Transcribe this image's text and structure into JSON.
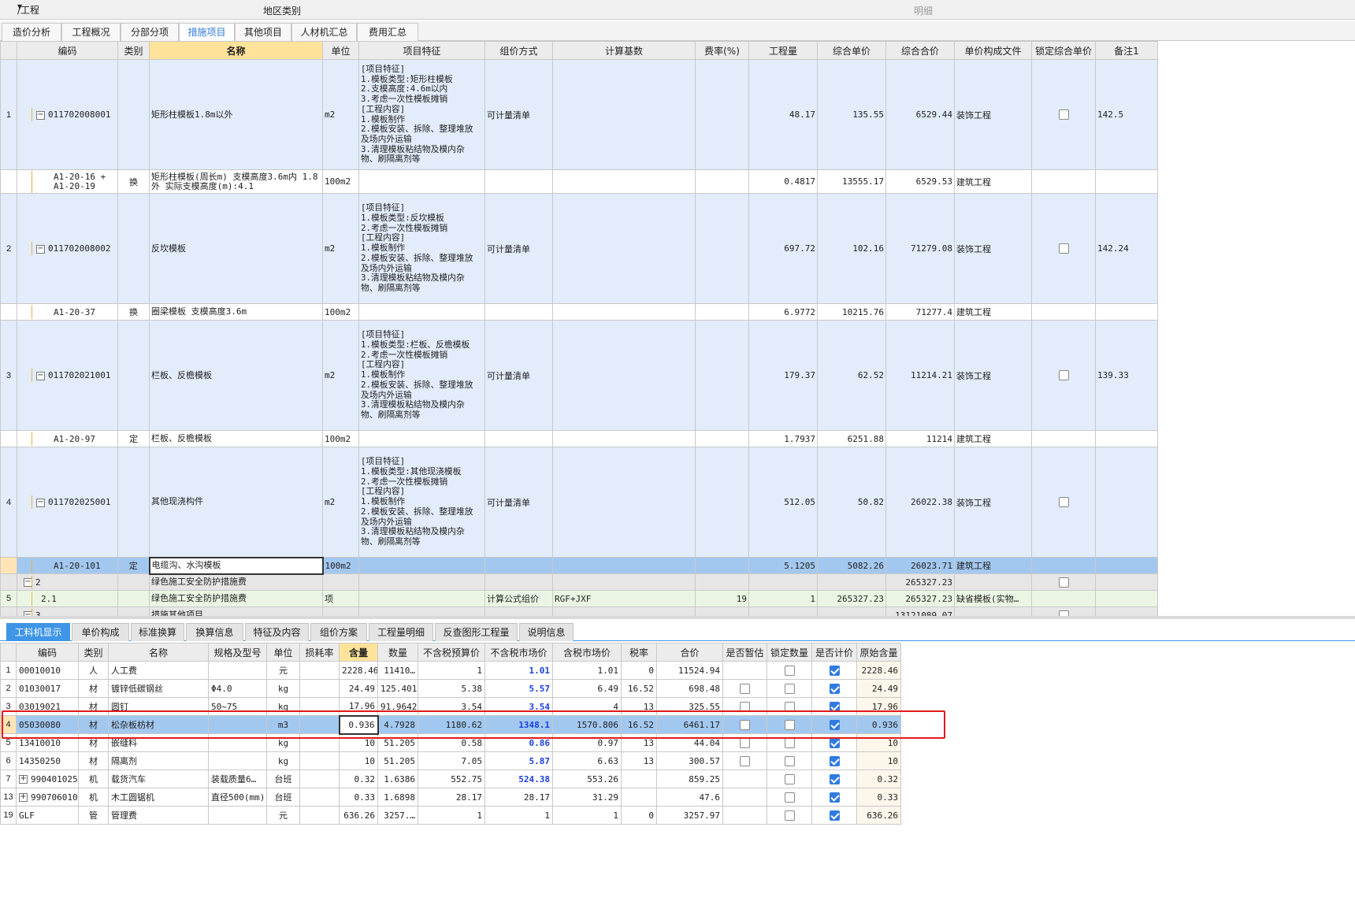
{
  "top_strip": {
    "left_label": "/工程",
    "center_label": "地区类别",
    "right_label": "明细"
  },
  "tabs": [
    {
      "label": "造价分析",
      "active": false
    },
    {
      "label": "工程概况",
      "active": false
    },
    {
      "label": "分部分项",
      "active": false
    },
    {
      "label": "措施项目",
      "active": true
    },
    {
      "label": "其他项目",
      "active": false
    },
    {
      "label": "人材机汇总",
      "active": false
    },
    {
      "label": "费用汇总",
      "active": false
    }
  ],
  "main_grid": {
    "columns": [
      "",
      "编码",
      "类别",
      "名称",
      "单位",
      "项目特征",
      "组价方式",
      "计算基数",
      "费率(%)",
      "工程量",
      "综合单价",
      "综合合价",
      "单价构成文件",
      "锁定综合单价",
      "备注1"
    ],
    "selected_column": "名称",
    "rows": [
      {
        "rn": "1",
        "kind": "qd",
        "code": "011702008001",
        "type": "",
        "name": "矩形柱模板1.8m以外",
        "unit": "m2",
        "features": "[项目特征]\n1.模板类型:矩形柱模板\n2.支模高度:4.6m以内\n3.考虑一次性模板摊销\n[工程内容]\n1.模板制作\n2.模板安装、拆除、整理堆放\n及场内外运输\n3.清理模板粘结物及模内杂\n物、刷隔离剂等",
        "method": "可计量清单",
        "base": "",
        "rate": "",
        "qty": "48.17",
        "price": "135.55",
        "total": "6529.44",
        "file": "装饰工程",
        "lock": "unchecked",
        "note": "142.5"
      },
      {
        "rn": "",
        "kind": "de",
        "code": "A1-20-16 +\nA1-20-19",
        "type": "换",
        "name": "矩形柱模板(周长m) 支模高度3.6m内 1.8\n外  实际支模高度(m):4.1",
        "unit": "100m2",
        "features": "",
        "method": "",
        "base": "",
        "rate": "",
        "qty": "0.4817",
        "price": "13555.17",
        "total": "6529.53",
        "file": "建筑工程",
        "lock": "none",
        "note": ""
      },
      {
        "rn": "2",
        "kind": "qd",
        "code": "011702008002",
        "type": "",
        "name": "反坎模板",
        "unit": "m2",
        "features": "[项目特征]\n1.模板类型:反坎模板\n2.考虑一次性模板摊销\n[工程内容]\n1.模板制作\n2.模板安装、拆除、整理堆放\n及场内外运输\n3.清理模板粘结物及模内杂\n物、刷隔离剂等",
        "method": "可计量清单",
        "base": "",
        "rate": "",
        "qty": "697.72",
        "price": "102.16",
        "total": "71279.08",
        "file": "装饰工程",
        "lock": "unchecked",
        "note": "142.24"
      },
      {
        "rn": "",
        "kind": "de",
        "code": "A1-20-37",
        "type": "换",
        "name": "圈梁模板 支模高度3.6m",
        "unit": "100m2",
        "features": "",
        "method": "",
        "base": "",
        "rate": "",
        "qty": "6.9772",
        "price": "10215.76",
        "total": "71277.4",
        "file": "建筑工程",
        "lock": "none",
        "note": ""
      },
      {
        "rn": "3",
        "kind": "qd",
        "code": "011702021001",
        "type": "",
        "name": "栏板、反檐模板",
        "unit": "m2",
        "features": "[项目特征]\n1.模板类型:栏板、反檐模板\n2.考虑一次性模板摊销\n[工程内容]\n1.模板制作\n2.模板安装、拆除、整理堆放\n及场内外运输\n3.清理模板粘结物及模内杂\n物、刷隔离剂等",
        "method": "可计量清单",
        "base": "",
        "rate": "",
        "qty": "179.37",
        "price": "62.52",
        "total": "11214.21",
        "file": "装饰工程",
        "lock": "unchecked",
        "note": "139.33"
      },
      {
        "rn": "",
        "kind": "de",
        "code": "A1-20-97",
        "type": "定",
        "name": "栏板、反檐模板",
        "unit": "100m2",
        "features": "",
        "method": "",
        "base": "",
        "rate": "",
        "qty": "1.7937",
        "price": "6251.88",
        "total": "11214",
        "file": "建筑工程",
        "lock": "none",
        "note": ""
      },
      {
        "rn": "4",
        "kind": "qd",
        "code": "011702025001",
        "type": "",
        "name": "其他现浇构件",
        "unit": "m2",
        "features": "[项目特征]\n1.模板类型:其他现浇模板\n2.考虑一次性模板摊销\n[工程内容]\n1.模板制作\n2.模板安装、拆除、整理堆放\n及场内外运输\n3.清理模板粘结物及模内杂\n物、刷隔离剂等",
        "method": "可计量清单",
        "base": "",
        "rate": "",
        "qty": "512.05",
        "price": "50.82",
        "total": "26022.38",
        "file": "装饰工程",
        "lock": "unchecked",
        "note": ""
      },
      {
        "rn": "",
        "kind": "cur",
        "code": "A1-20-101",
        "type": "定",
        "name": "电缆沟、水沟模板",
        "unit": "100m2",
        "features": "",
        "method": "",
        "base": "",
        "rate": "",
        "qty": "5.1205",
        "price": "5082.26",
        "total": "26023.71",
        "file": "建筑工程",
        "lock": "none",
        "note": ""
      },
      {
        "rn": "",
        "kind": "grp",
        "code": "2",
        "type": "",
        "name": "绿色施工安全防护措施费",
        "unit": "",
        "features": "",
        "method": "",
        "base": "",
        "rate": "",
        "qty": "",
        "price": "",
        "total": "265327.23",
        "file": "",
        "lock": "unchecked",
        "note": ""
      },
      {
        "rn": "5",
        "kind": "lit",
        "code": "2.1",
        "type": "",
        "name": "绿色施工安全防护措施费",
        "unit": "项",
        "features": "",
        "method": "计算公式组价",
        "base": "RGF+JXF",
        "rate": "19",
        "qty": "1",
        "price": "265327.23",
        "total": "265327.23",
        "file": "缺省模板(实物…",
        "lock": "none",
        "note": ""
      },
      {
        "rn": "",
        "kind": "grp",
        "code": "3",
        "type": "",
        "name": "措施其他项目",
        "unit": "",
        "features": "",
        "method": "",
        "base": "",
        "rate": "",
        "qty": "",
        "price": "",
        "total": "13121089.07",
        "file": "",
        "lock": "unchecked",
        "note": ""
      }
    ]
  },
  "bottom_tabs": [
    {
      "label": "工料机显示",
      "active": true
    },
    {
      "label": "单价构成",
      "active": false
    },
    {
      "label": "标准换算",
      "active": false
    },
    {
      "label": "换算信息",
      "active": false
    },
    {
      "label": "特征及内容",
      "active": false
    },
    {
      "label": "组价方案",
      "active": false
    },
    {
      "label": "工程量明细",
      "active": false
    },
    {
      "label": "反查图形工程量",
      "active": false
    },
    {
      "label": "说明信息",
      "active": false
    }
  ],
  "sub_grid": {
    "columns": [
      "",
      "编码",
      "类别",
      "名称",
      "规格及型号",
      "单位",
      "损耗率",
      "含量",
      "数量",
      "不含税预算价",
      "不含税市场价",
      "含税市场价",
      "税率",
      "合价",
      "是否暂估",
      "锁定数量",
      "是否计价",
      "原始含量"
    ],
    "selected_column": "含量",
    "rows": [
      {
        "rn": "1",
        "exp": false,
        "code": "00010010",
        "type": "人",
        "name": "人工费",
        "spec": "",
        "unit": "元",
        "loss": "",
        "content": "2228.46",
        "qty": "11410…",
        "budget": "1",
        "market": "1.01",
        "market_tax": "1.01",
        "tax": "0",
        "total": "11524.94",
        "est": "none",
        "lockq": "unchecked",
        "priced": "checked",
        "orig": "2228.46",
        "cur": false
      },
      {
        "rn": "2",
        "exp": false,
        "code": "01030017",
        "type": "材",
        "name": "镀锌低碳钢丝",
        "spec": "Φ4.0",
        "unit": "kg",
        "loss": "",
        "content": "24.49",
        "qty": "125.401",
        "budget": "5.38",
        "market": "5.57",
        "market_tax": "6.49",
        "tax": "16.52",
        "total": "698.48",
        "est": "unchecked",
        "lockq": "unchecked",
        "priced": "checked",
        "orig": "24.49",
        "cur": false
      },
      {
        "rn": "3",
        "exp": false,
        "code": "03019021",
        "type": "材",
        "name": "圆钉",
        "spec": "50~75",
        "unit": "kg",
        "loss": "",
        "content": "17.96",
        "qty": "91.9642",
        "budget": "3.54",
        "market": "3.54",
        "market_tax": "4",
        "tax": "13",
        "total": "325.55",
        "est": "unchecked",
        "lockq": "unchecked",
        "priced": "checked",
        "orig": "17.96",
        "cur": false
      },
      {
        "rn": "4",
        "exp": false,
        "code": "05030080",
        "type": "材",
        "name": "松杂板枋材",
        "spec": "",
        "unit": "m3",
        "loss": "",
        "content": "0.936",
        "qty": "4.7928",
        "budget": "1180.62",
        "market": "1348.1",
        "market_tax": "1570.806",
        "tax": "16.52",
        "total": "6461.17",
        "est": "unchecked",
        "lockq": "unchecked",
        "priced": "checked",
        "orig": "0.936",
        "cur": true
      },
      {
        "rn": "5",
        "exp": false,
        "code": "13410010",
        "type": "材",
        "name": "嵌缝料",
        "spec": "",
        "unit": "kg",
        "loss": "",
        "content": "10",
        "qty": "51.205",
        "budget": "0.58",
        "market": "0.86",
        "market_tax": "0.97",
        "tax": "13",
        "total": "44.04",
        "est": "unchecked",
        "lockq": "unchecked",
        "priced": "checked",
        "orig": "10",
        "cur": false
      },
      {
        "rn": "6",
        "exp": false,
        "code": "14350250",
        "type": "材",
        "name": "隔离剂",
        "spec": "",
        "unit": "kg",
        "loss": "",
        "content": "10",
        "qty": "51.205",
        "budget": "7.05",
        "market": "5.87",
        "market_tax": "6.63",
        "tax": "13",
        "total": "300.57",
        "est": "unchecked",
        "lockq": "unchecked",
        "priced": "checked",
        "orig": "10",
        "cur": false
      },
      {
        "rn": "7",
        "exp": true,
        "code": "990401025",
        "type": "机",
        "name": "载货汽车",
        "spec": "装载质量6…",
        "unit": "台班",
        "loss": "",
        "content": "0.32",
        "qty": "1.6386",
        "budget": "552.75",
        "market": "524.38",
        "market_tax": "553.26",
        "tax": "",
        "total": "859.25",
        "est": "none",
        "lockq": "unchecked",
        "priced": "checked",
        "orig": "0.32",
        "cur": false
      },
      {
        "rn": "13",
        "exp": true,
        "code": "990706010",
        "type": "机",
        "name": "木工圆锯机",
        "spec": "直径500(mm)",
        "unit": "台班",
        "loss": "",
        "content": "0.33",
        "qty": "1.6898",
        "budget": "28.17",
        "market": "28.17",
        "market_tax": "31.29",
        "tax": "",
        "total": "47.6",
        "est": "none",
        "lockq": "unchecked",
        "priced": "checked",
        "orig": "0.33",
        "cur": false
      },
      {
        "rn": "19",
        "exp": false,
        "code": "GLF",
        "type": "管",
        "name": "管理费",
        "spec": "",
        "unit": "元",
        "loss": "",
        "content": "636.26",
        "qty": "3257.…",
        "budget": "1",
        "market": "1",
        "market_tax": "1",
        "tax": "0",
        "total": "3257.97",
        "est": "none",
        "lockq": "unchecked",
        "priced": "checked",
        "orig": "636.26",
        "cur": false
      }
    ],
    "blue_market_rows": [
      "1",
      "2",
      "3",
      "4",
      "5",
      "6",
      "7"
    ]
  },
  "colors": {
    "accent": "#3f95e6",
    "highlight_row": "#a3c8f0",
    "bill_row": "#e2ecfa",
    "annotation": "#e01b1b"
  }
}
